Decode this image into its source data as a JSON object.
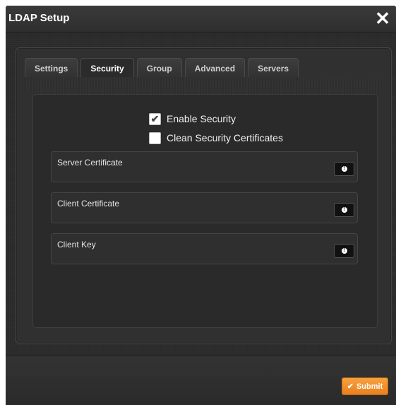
{
  "window": {
    "title": "LDAP Setup",
    "close_glyph": "✕"
  },
  "tabs": [
    {
      "label": "Settings"
    },
    {
      "label": "Security"
    },
    {
      "label": "Group"
    },
    {
      "label": "Advanced"
    },
    {
      "label": "Servers"
    }
  ],
  "active_tab": "Security",
  "security": {
    "enable_security": {
      "label": "Enable Security",
      "checked": true
    },
    "clean_certificates": {
      "label": "Clean Security Certificates",
      "checked": false
    },
    "fields": [
      {
        "label": "Server Certificate",
        "icon": "info-icon"
      },
      {
        "label": "Client Certificate",
        "icon": "info-icon"
      },
      {
        "label": "Client Key",
        "icon": "info-icon"
      }
    ]
  },
  "footer": {
    "submit_label": "Submit",
    "submit_icon": "check-icon"
  },
  "colors": {
    "accent": "#f28c28",
    "background": "#2b2b2b"
  }
}
